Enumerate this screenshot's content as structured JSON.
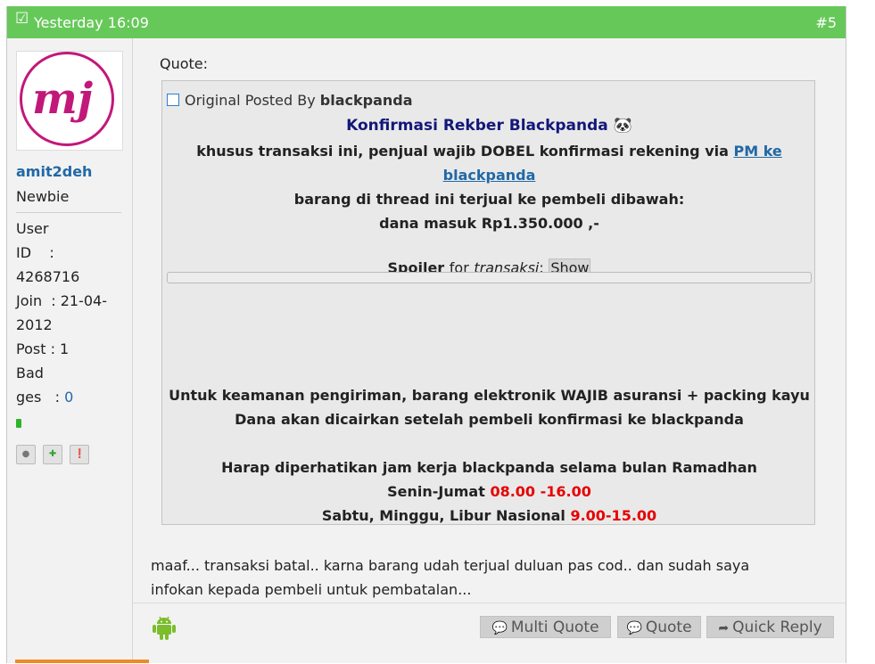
{
  "post": {
    "date": "Yesterday 16:09",
    "number": "#5"
  },
  "user": {
    "avatar_text": "mj",
    "name": "amit2deh",
    "title": "Newbie",
    "info_lines": [
      "User",
      "ID    :",
      "4268716",
      "Join  : 21-04-",
      "2012",
      "Post : 1",
      "Bad",
      "ges   : "
    ],
    "badges_count": "0"
  },
  "quote": {
    "label": "Quote:",
    "posted_by_prefix": "Original Posted By",
    "author": "blackpanda",
    "title": "Konfirmasi Rekber Blackpanda",
    "line1_text": "khusus transaksi ini, penjual wajib DOBEL konfirmasi rekening via",
    "line1_link_a": "PM ke",
    "line1_link_b": "blackpanda",
    "line2": "barang di thread ini terjual ke pembeli dibawah:",
    "line3": "dana masuk Rp1.350.000 ,-",
    "spoiler_label": "Spoiler",
    "spoiler_for": "for",
    "spoiler_name": "transaksi",
    "spoiler_colon": ":",
    "spoiler_button": "Show",
    "line4": "Untuk keamanan pengiriman, barang elektronik WAJIB asuransi + packing kayu",
    "line5": "Dana akan dicairkan setelah pembeli konfirmasi ke blackpanda",
    "line6": "Harap diperhatikan jam kerja blackpanda selama bulan Ramadhan",
    "line7_text": "Senin-Jumat",
    "line7_time": "08.00 -16.00",
    "line8_text": "Sabtu, Minggu, Libur Nasional",
    "line8_time": "9.00-15.00"
  },
  "message": {
    "line1": "maaf... transaksi batal.. karna barang udah terjual duluan pas cod.. dan sudah saya",
    "line2": "infokan kepada pembeli untuk pembatalan..."
  },
  "footer": {
    "multi_quote": "Multi Quote",
    "quote": "Quote",
    "quick_reply": "Quick Reply"
  },
  "colors": {
    "header_bg": "#67c85a",
    "link": "#2168a6",
    "time_red": "#e60000",
    "title_navy": "#121879"
  }
}
